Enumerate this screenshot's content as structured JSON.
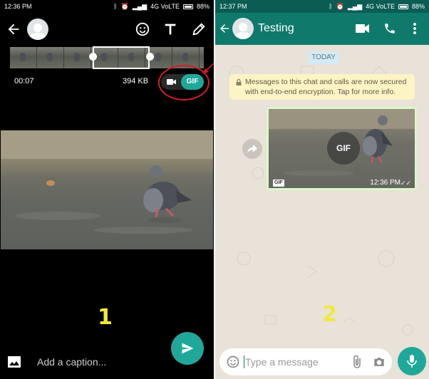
{
  "left": {
    "status": {
      "time": "12:36 PM",
      "network": "4G VoLTE",
      "battery": "88%"
    },
    "duration": "00:07",
    "file_size": "394 KB",
    "gif_label": "GIF",
    "caption_placeholder": "Add a caption...",
    "step": "1",
    "icons": [
      "back-arrow-icon",
      "emoji-icon",
      "text-icon",
      "pencil-icon",
      "video-camera-icon",
      "gallery-icon",
      "send-icon"
    ]
  },
  "right": {
    "status": {
      "time": "12:37 PM",
      "network": "4G VoLTE",
      "battery": "88%"
    },
    "chat_title": "Testing",
    "date_chip": "TODAY",
    "encryption_line1": "Messages to this chat and calls are now secured",
    "encryption_line2": "with end-to-end encryption. Tap for more info.",
    "gif_overlay": "GIF",
    "gif_badge": "GIF",
    "message_time": "12:36 PM",
    "input_placeholder": "Type a message",
    "step": "2",
    "icons": [
      "back-arrow-icon",
      "video-call-icon",
      "phone-icon",
      "more-vert-icon",
      "forward-icon",
      "smiley-icon",
      "attach-icon",
      "camera-icon",
      "mic-icon"
    ]
  },
  "colors": {
    "accent": "#1fa89a",
    "appbar": "#0f7a6c",
    "bubble": "#dcf8c6",
    "step": "#f1e93c",
    "highlight": "#d41d25"
  }
}
